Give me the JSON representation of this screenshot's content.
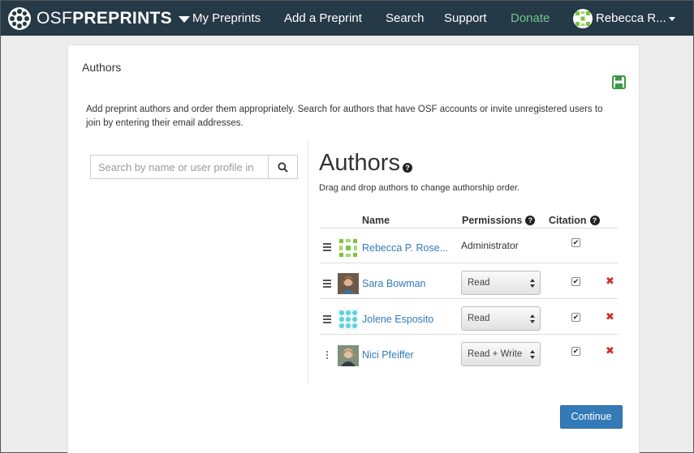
{
  "navbar": {
    "brand_osf": "OSF",
    "brand_preprints": "PREPRINTS",
    "links": [
      "My Preprints",
      "Add a Preprint",
      "Search",
      "Support"
    ],
    "donate": "Donate",
    "user_name": "Rebecca R..."
  },
  "panel": {
    "title": "Authors",
    "description": "Add preprint authors and order them appropriately. Search for authors that have OSF accounts or invite unregistered users to join by entering their email addresses.",
    "search_placeholder": "Search by name or user profile in",
    "heading": "Authors",
    "drag_hint": "Drag and drop authors to change authorship order.",
    "columns": {
      "name": "Name",
      "permissions": "Permissions",
      "citation": "Citation"
    },
    "authors": [
      {
        "name": "Rebecca P. Rose...",
        "permission": "Administrator",
        "editable": false,
        "citation": true,
        "removable": false
      },
      {
        "name": "Sara Bowman",
        "permission": "Read",
        "editable": true,
        "citation": true,
        "removable": true
      },
      {
        "name": "Jolene Esposito",
        "permission": "Read",
        "editable": true,
        "citation": true,
        "removable": true
      },
      {
        "name": "Nici Pfeiffer",
        "permission": "Read + Write",
        "editable": true,
        "citation": true,
        "removable": true
      }
    ],
    "continue_label": "Continue"
  },
  "colors": {
    "navbar": "#263947",
    "donate": "#71c68a",
    "link": "#337ab7",
    "remove": "#c9302c",
    "save_icon": "#3d9a46"
  }
}
